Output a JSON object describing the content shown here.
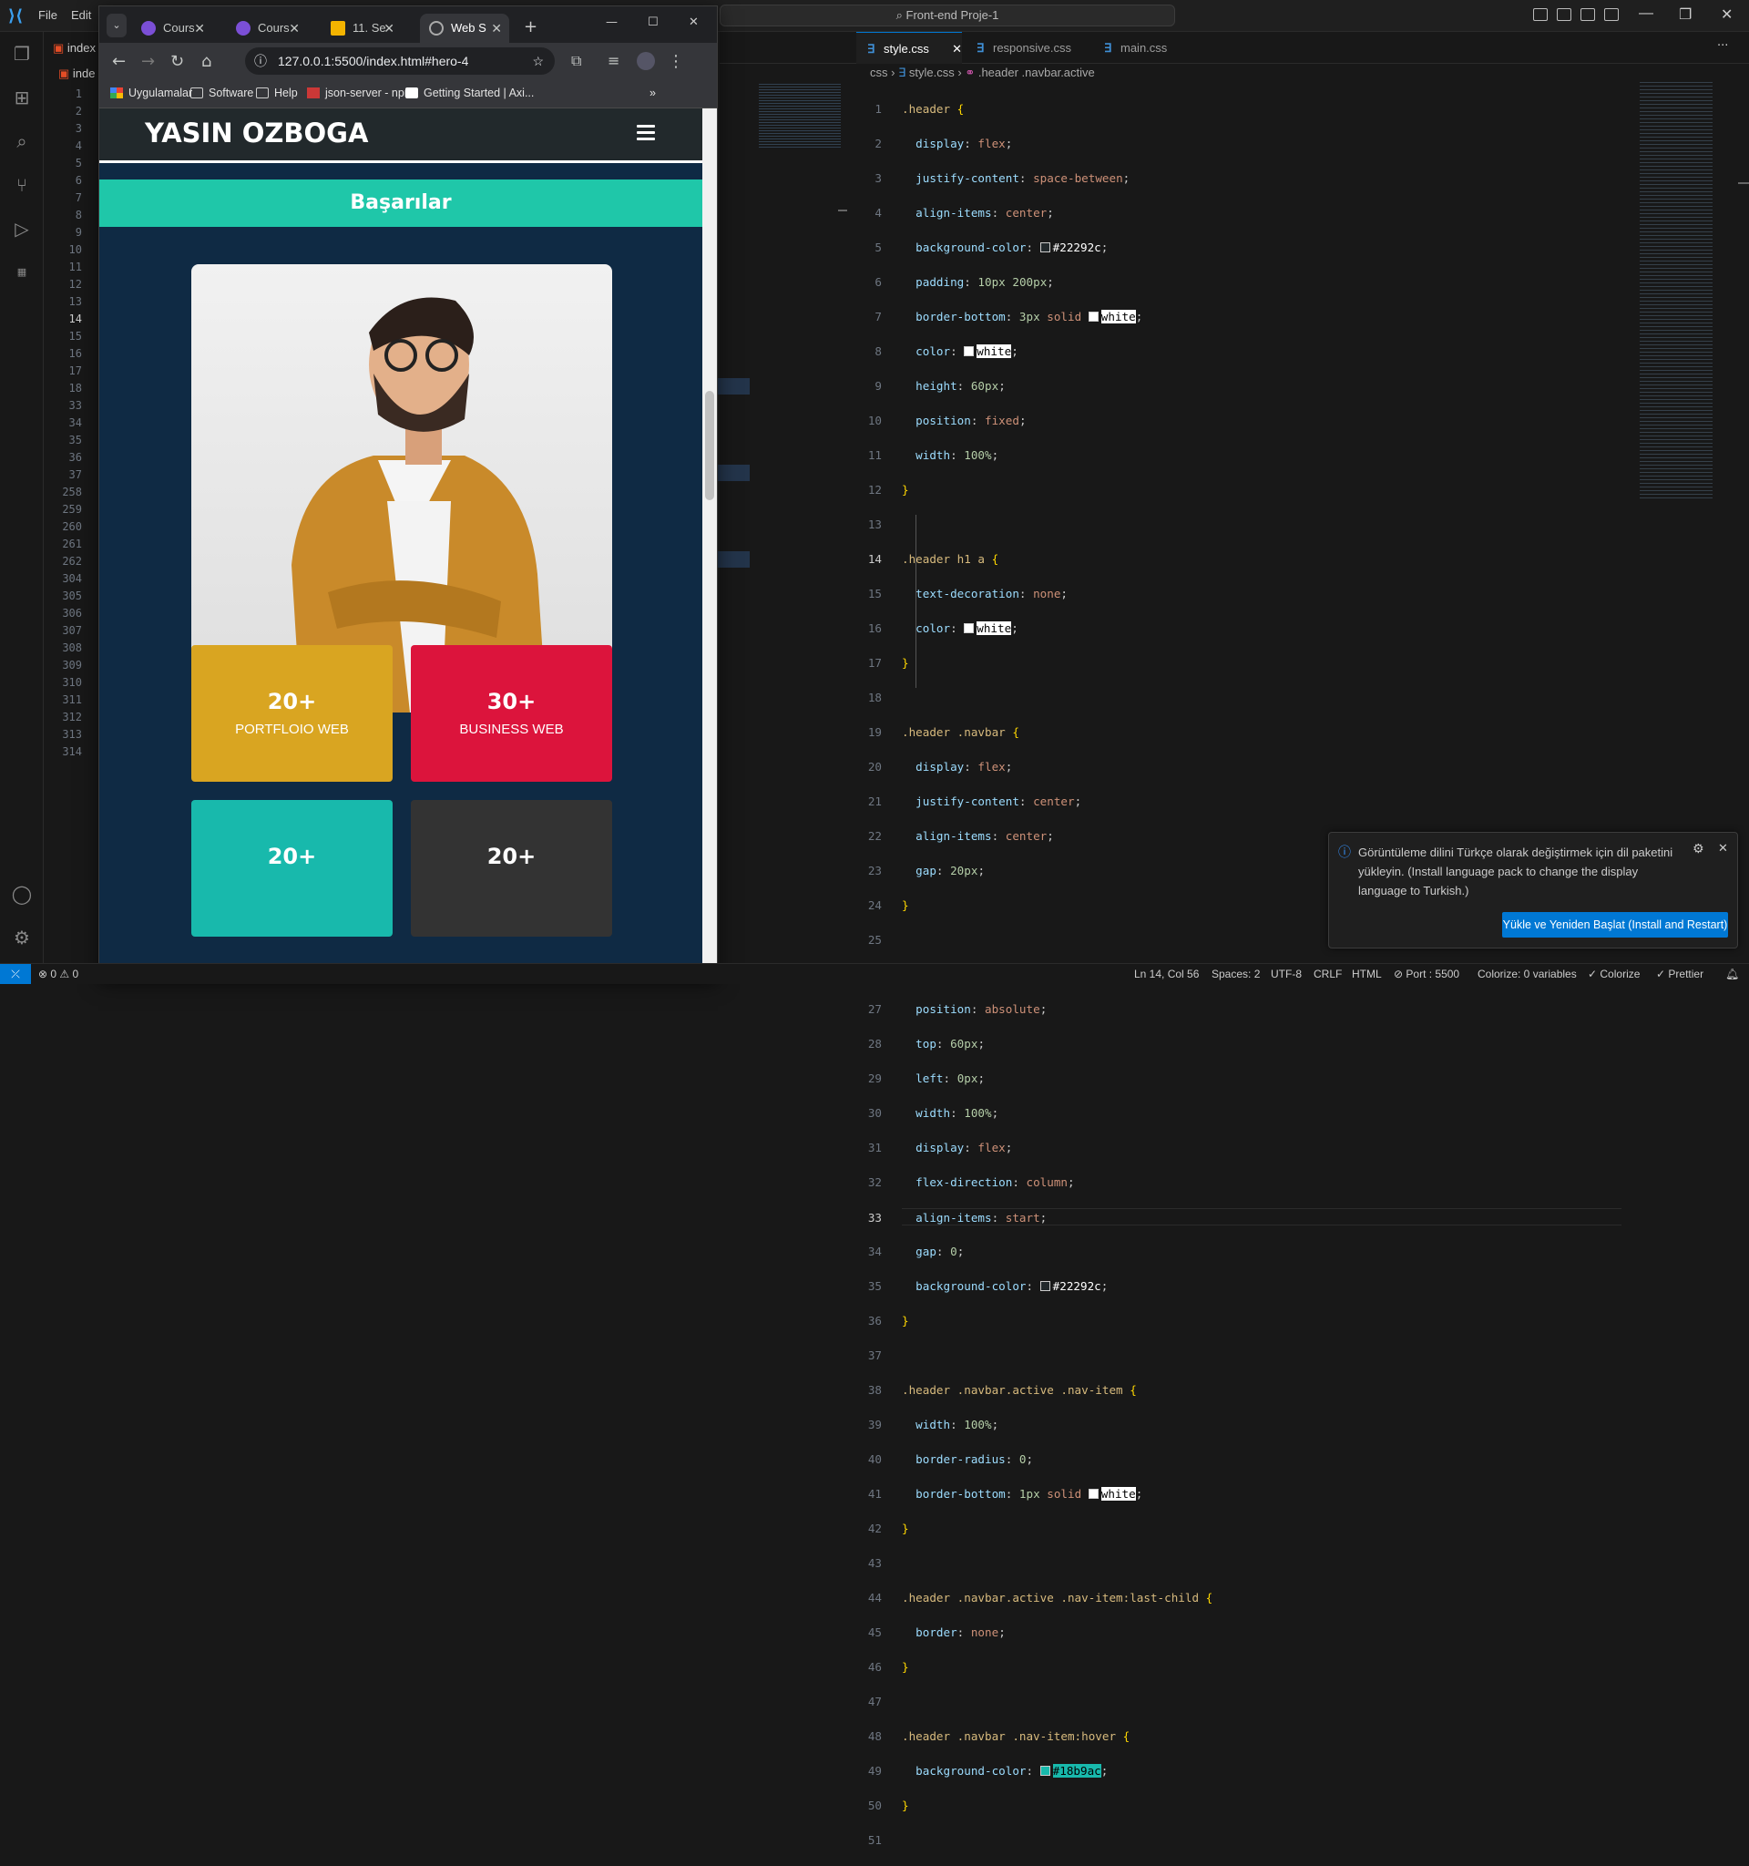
{
  "menu": {
    "file": "File",
    "edit": "Edit"
  },
  "command_center": "Front-end Proje-1",
  "left_editor": {
    "tab1": "index",
    "tab2": "inde",
    "line_numbers": [
      "1",
      "2",
      "3",
      "4",
      "5",
      "6",
      "7",
      "8",
      "9",
      "10",
      "11",
      "12",
      "13",
      "14",
      "15",
      "16",
      "17",
      "18",
      "33",
      "34",
      "35",
      "36",
      "37",
      "258",
      "259",
      "260",
      "261",
      "262",
      "304",
      "305",
      "306",
      "307",
      "308",
      "309",
      "310",
      "311",
      "312",
      "313",
      "314"
    ]
  },
  "editor_tabs": [
    {
      "label": "style.css"
    },
    {
      "label": "responsive.css"
    },
    {
      "label": "main.css"
    }
  ],
  "breadcrumb": {
    "folder": "css",
    "file": "style.css",
    "symbol": ".header .navbar.active"
  },
  "browser": {
    "tabs": [
      {
        "label": "Cours"
      },
      {
        "label": "Cours"
      },
      {
        "label": "11. Se"
      },
      {
        "label": "Web S"
      }
    ],
    "url": "127.0.0.1:5500/index.html#hero-4",
    "bookmarks": [
      "Uygulamalar",
      "Software",
      "Help",
      "json-server - npm",
      "Getting Started | Axi..."
    ],
    "site": {
      "logo": "YASIN OZBOGA",
      "banner": "Başarılar",
      "cards": [
        {
          "number": "20+",
          "label": "PORTFLOIO WEB",
          "color": "#d9a521"
        },
        {
          "number": "30+",
          "label": "BUSINESS WEB",
          "color": "#dc143c"
        },
        {
          "number": "20+",
          "label": "",
          "color": "#18b9ac"
        },
        {
          "number": "20+",
          "label": "",
          "color": "#333333"
        }
      ]
    }
  },
  "notification": {
    "text": "Görüntüleme dilini Türkçe olarak değiştirmek için dil paketini yükleyin. (Install language pack to change the display language to Turkish.)",
    "button": "Yükle ve Yeniden Başlat (Install and Restart)"
  },
  "status": {
    "errors": "0",
    "warnings": "0",
    "position": "Ln 14, Col 56",
    "spaces": "Spaces: 2",
    "encoding": "UTF-8",
    "eol": "CRLF",
    "language": "HTML",
    "port": "Port : 5500",
    "colorize": "Colorize: 0 variables",
    "colorize2": "Colorize",
    "prettier": "Prettier"
  }
}
